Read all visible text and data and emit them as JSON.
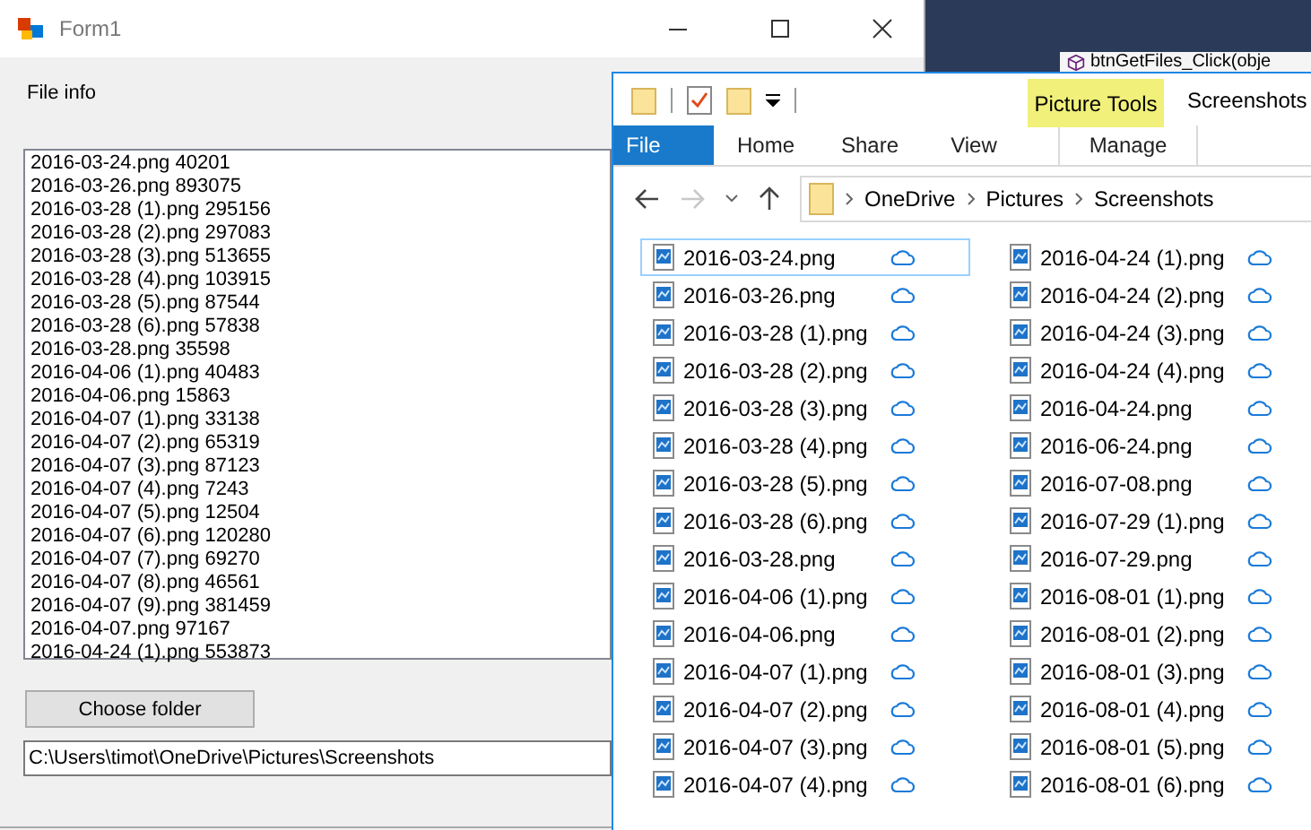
{
  "background_window": {
    "tab_title": "btnGetFiles_Click(obje"
  },
  "form": {
    "title": "Form1",
    "label": "File info",
    "listbox_items": [
      "2016-03-24.png 40201",
      "2016-03-26.png 893075",
      "2016-03-28 (1).png 295156",
      "2016-03-28 (2).png 297083",
      "2016-03-28 (3).png 513655",
      "2016-03-28 (4).png 103915",
      "2016-03-28 (5).png 87544",
      "2016-03-28 (6).png 57838",
      "2016-03-28.png 35598",
      "2016-04-06 (1).png 40483",
      "2016-04-06.png 15863",
      "2016-04-07 (1).png 33138",
      "2016-04-07 (2).png 65319",
      "2016-04-07 (3).png 87123",
      "2016-04-07 (4).png 7243",
      "2016-04-07 (5).png 12504",
      "2016-04-07 (6).png 120280",
      "2016-04-07 (7).png 69270",
      "2016-04-07 (8).png 46561",
      "2016-04-07 (9).png 381459",
      "2016-04-07.png 97167",
      "2016-04-24 (1).png 553873"
    ],
    "choose_button": "Choose folder",
    "path_field": {
      "value": "C:\\Users\\timot\\OneDrive\\Pictures\\Screenshots"
    }
  },
  "explorer": {
    "context_tab": "Picture Tools",
    "title": "Screenshots",
    "ribbon_tabs": [
      {
        "label": "File",
        "kind": "file",
        "selected": false
      },
      {
        "label": "Home",
        "kind": "tab",
        "selected": false
      },
      {
        "label": "Share",
        "kind": "tab",
        "selected": false
      },
      {
        "label": "View",
        "kind": "tab",
        "selected": false
      },
      {
        "label": "Manage",
        "kind": "contextual",
        "selected": false
      }
    ],
    "breadcrumb": [
      "OneDrive",
      "Pictures",
      "Screenshots"
    ],
    "files": [
      {
        "name": "2016-03-24.png",
        "selected": true
      },
      {
        "name": "2016-03-26.png",
        "selected": false
      },
      {
        "name": "2016-03-28 (1).png",
        "selected": false
      },
      {
        "name": "2016-03-28 (2).png",
        "selected": false
      },
      {
        "name": "2016-03-28 (3).png",
        "selected": false
      },
      {
        "name": "2016-03-28 (4).png",
        "selected": false
      },
      {
        "name": "2016-03-28 (5).png",
        "selected": false
      },
      {
        "name": "2016-03-28 (6).png",
        "selected": false
      },
      {
        "name": "2016-03-28.png",
        "selected": false
      },
      {
        "name": "2016-04-06 (1).png",
        "selected": false
      },
      {
        "name": "2016-04-06.png",
        "selected": false
      },
      {
        "name": "2016-04-07 (1).png",
        "selected": false
      },
      {
        "name": "2016-04-07 (2).png",
        "selected": false
      },
      {
        "name": "2016-04-07 (3).png",
        "selected": false
      },
      {
        "name": "2016-04-07 (4).png",
        "selected": false
      },
      {
        "name": "2016-04-24 (1).png",
        "selected": false
      },
      {
        "name": "2016-04-24 (2).png",
        "selected": false
      },
      {
        "name": "2016-04-24 (3).png",
        "selected": false
      },
      {
        "name": "2016-04-24 (4).png",
        "selected": false
      },
      {
        "name": "2016-04-24.png",
        "selected": false
      },
      {
        "name": "2016-06-24.png",
        "selected": false
      },
      {
        "name": "2016-07-08.png",
        "selected": false
      },
      {
        "name": "2016-07-29 (1).png",
        "selected": false
      },
      {
        "name": "2016-07-29.png",
        "selected": false
      },
      {
        "name": "2016-08-01 (1).png",
        "selected": false
      },
      {
        "name": "2016-08-01 (2).png",
        "selected": false
      },
      {
        "name": "2016-08-01 (3).png",
        "selected": false
      },
      {
        "name": "2016-08-01 (4).png",
        "selected": false
      },
      {
        "name": "2016-08-01 (5).png",
        "selected": false
      },
      {
        "name": "2016-08-01 (6).png",
        "selected": false
      }
    ]
  }
}
